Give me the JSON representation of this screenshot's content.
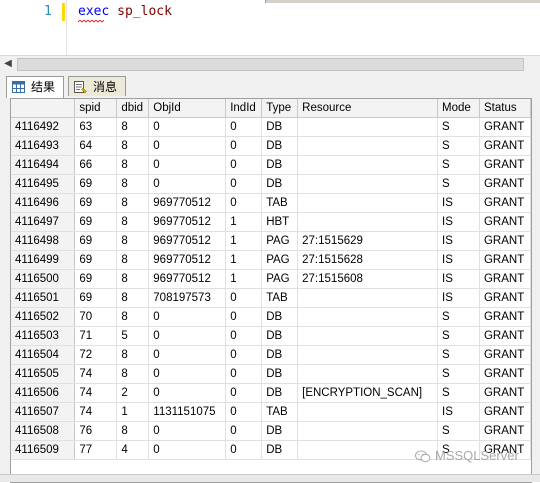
{
  "editor": {
    "line_number": "1",
    "keyword": "exec",
    "procedure": "sp_lock"
  },
  "tabs": [
    {
      "label": "结果",
      "icon": "grid-icon",
      "active": true
    },
    {
      "label": "消息",
      "icon": "message-icon",
      "active": false
    }
  ],
  "grid": {
    "columns": [
      "",
      "spid",
      "dbid",
      "ObjId",
      "IndId",
      "Type",
      "Resource",
      "Mode",
      "Status"
    ],
    "rows": [
      [
        "4116492",
        "63",
        "8",
        "0",
        "0",
        "DB",
        "",
        "S",
        "GRANT"
      ],
      [
        "4116493",
        "64",
        "8",
        "0",
        "0",
        "DB",
        "",
        "S",
        "GRANT"
      ],
      [
        "4116494",
        "66",
        "8",
        "0",
        "0",
        "DB",
        "",
        "S",
        "GRANT"
      ],
      [
        "4116495",
        "69",
        "8",
        "0",
        "0",
        "DB",
        "",
        "S",
        "GRANT"
      ],
      [
        "4116496",
        "69",
        "8",
        "969770512",
        "0",
        "TAB",
        "",
        "IS",
        "GRANT"
      ],
      [
        "4116497",
        "69",
        "8",
        "969770512",
        "1",
        "HBT",
        "",
        "IS",
        "GRANT"
      ],
      [
        "4116498",
        "69",
        "8",
        "969770512",
        "1",
        "PAG",
        "27:1515629",
        "IS",
        "GRANT"
      ],
      [
        "4116499",
        "69",
        "8",
        "969770512",
        "1",
        "PAG",
        "27:1515628",
        "IS",
        "GRANT"
      ],
      [
        "4116500",
        "69",
        "8",
        "969770512",
        "1",
        "PAG",
        "27:1515608",
        "IS",
        "GRANT"
      ],
      [
        "4116501",
        "69",
        "8",
        "708197573",
        "0",
        "TAB",
        "",
        "IS",
        "GRANT"
      ],
      [
        "4116502",
        "70",
        "8",
        "0",
        "0",
        "DB",
        "",
        "S",
        "GRANT"
      ],
      [
        "4116503",
        "71",
        "5",
        "0",
        "0",
        "DB",
        "",
        "S",
        "GRANT"
      ],
      [
        "4116504",
        "72",
        "8",
        "0",
        "0",
        "DB",
        "",
        "S",
        "GRANT"
      ],
      [
        "4116505",
        "74",
        "8",
        "0",
        "0",
        "DB",
        "",
        "S",
        "GRANT"
      ],
      [
        "4116506",
        "74",
        "2",
        "0",
        "0",
        "DB",
        "[ENCRYPTION_SCAN]",
        "S",
        "GRANT"
      ],
      [
        "4116507",
        "74",
        "1",
        "1131151075",
        "0",
        "TAB",
        "",
        "IS",
        "GRANT"
      ],
      [
        "4116508",
        "76",
        "8",
        "0",
        "0",
        "DB",
        "",
        "S",
        "GRANT"
      ],
      [
        "4116509",
        "77",
        "4",
        "0",
        "0",
        "DB",
        "",
        "S",
        "GRANT"
      ]
    ]
  },
  "watermark": {
    "text": "MSSQLServer",
    "icon": "wechat-icon"
  },
  "colors": {
    "keyword": "#0000ff",
    "identifier": "#800000",
    "line_number": "#2b91af",
    "change_bar": "#ffd800"
  }
}
